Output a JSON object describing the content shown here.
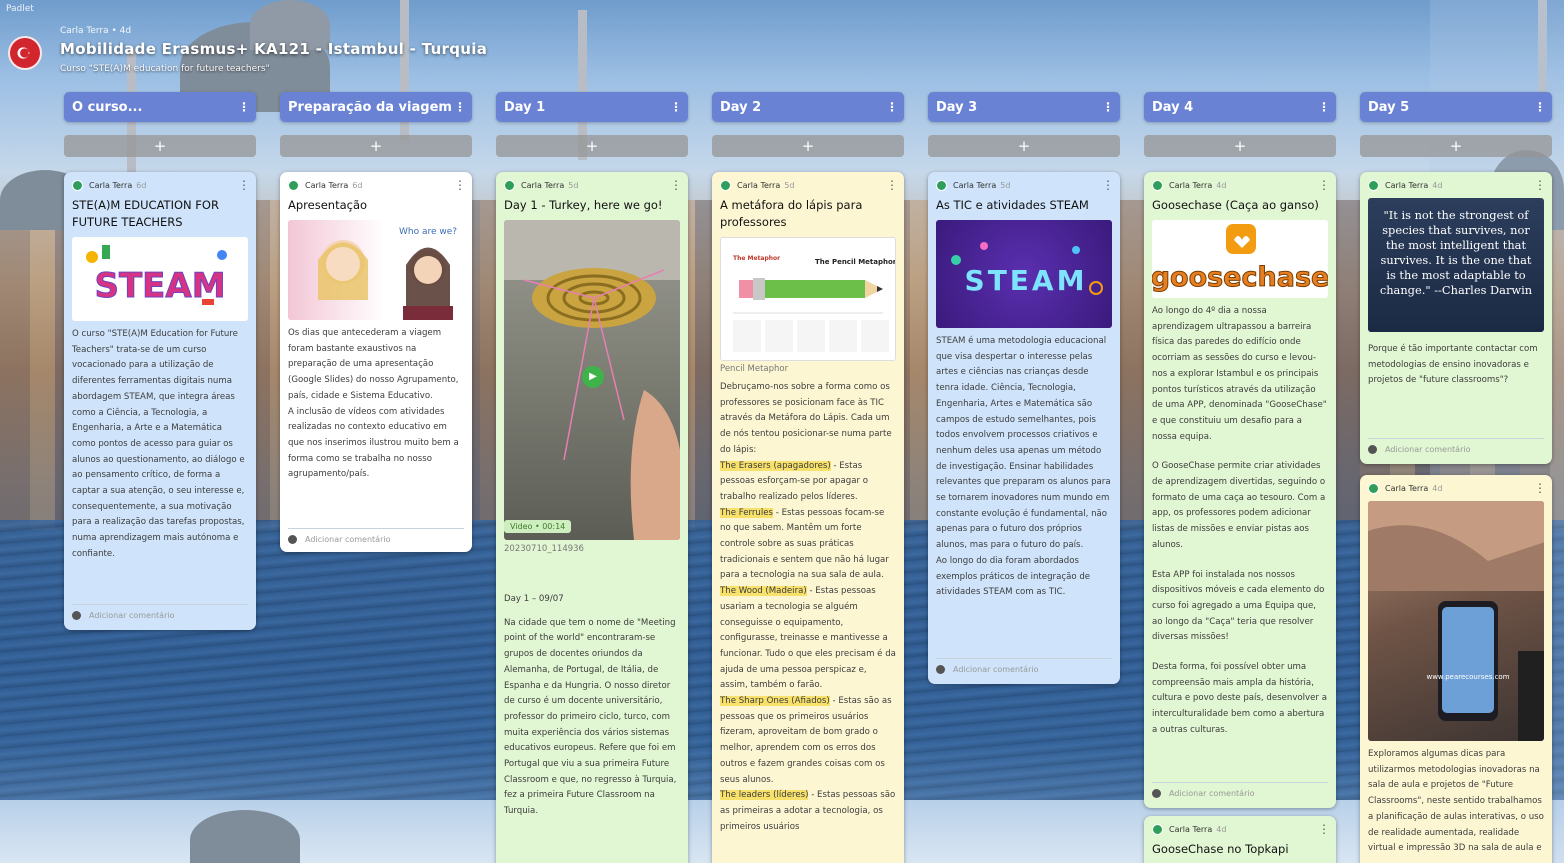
{
  "app": {
    "brand": "Padlet"
  },
  "board": {
    "author_meta": "Carla Terra • 4d",
    "title": "Mobilidade Erasmus+ KA121 - Istambul - Turquia",
    "subtitle": "Curso \"STE(A)M education for future teachers\"",
    "flag_icon": "turkey-flag-icon"
  },
  "add_label": "+",
  "comment_label": "Adicionar comentário",
  "author": "Carla Terra",
  "columns": [
    {
      "title": "O curso..."
    },
    {
      "title": "Preparação da viagem"
    },
    {
      "title": "Day 1"
    },
    {
      "title": "Day 2"
    },
    {
      "title": "Day 3"
    },
    {
      "title": "Day 4"
    },
    {
      "title": "Day 5"
    }
  ],
  "cards": {
    "c1": {
      "ago": "6d",
      "title": "STE(A)M EDUCATION FOR FUTURE TEACHERS",
      "image_text": "STEAM",
      "body": "O curso \"STE(A)M Education for Future Teachers\" trata-se de um curso vocacionado para a utilização de diferentes ferramentas digitais numa abordagem STEAM, que integra áreas como a Ciência, a Tecnologia, a Engenharia, a Arte e a Matemática como pontos de acesso para guiar os alunos ao questionamento, ao diálogo e ao pensamento crítico, de forma a captar a sua atenção, o seu interesse e, consequentemente, a sua motivação para a realização das tarefas propostas, numa aprendizagem mais autónoma e confiante."
    },
    "c2": {
      "ago": "6d",
      "title": "Apresentação",
      "image_text": "Who are we?",
      "body": "Os dias que antecederam a viagem foram bastante exaustivos na preparação de uma apresentação (Google Slides) do nosso Agrupamento, país, cidade e Sistema Educativo.\nA inclusão de vídeos com atividades realizadas no contexto educativo em que nos inserimos ilustrou muito bem a forma como se trabalha no nosso agrupamento/país."
    },
    "c3": {
      "ago": "5d",
      "title": "Day 1 - Turkey, here we go!",
      "video_label": "Video • 00:14",
      "caption": "20230710_114936",
      "body_date": "Day 1 – 09/07",
      "body": "Na cidade que tem o nome de \"Meeting point of the world\" encontraram-se grupos de docentes oriundos da Alemanha, de Portugal, de Itália, de Espanha e da Hungria. O nosso diretor de curso é um docente universitário, professor do primeiro ciclo, turco, com muita experiência dos vários sistemas educativos europeus. Refere que foi em Portugal que viu a sua primeira Future Classroom e que, no regresso à Turquia, fez a primeira Future Classroom na Turquia."
    },
    "c4": {
      "ago": "5d",
      "title": "A metáfora do lápis para professores",
      "image_title": "The Pencil Metaphor",
      "image_sub": "The Metaphor",
      "caption": "Pencil Metaphor",
      "intro": "Debruçamo-nos sobre a forma como os professores se posicionam face às TIC através da Metáfora do Lápis. Cada um de nós tentou posicionar-se numa parte do lápis:",
      "items": [
        {
          "term": "The Erasers (apagadores)",
          "text": " - Estas pessoas esforçam-se por apagar o trabalho realizado pelos líderes."
        },
        {
          "term": "The Ferrules",
          "text": " - Estas pessoas focam-se no que sabem. Mantêm um forte controle sobre as suas práticas tradicionais e sentem que não há lugar para a tecnologia na sua sala de aula."
        },
        {
          "term": "The Wood (Madeira)",
          "text": " - Estas pessoas usariam a tecnologia se alguém conseguisse o equipamento, configurasse, treinasse e mantivesse a funcionar. Tudo o que eles precisam é da ajuda de uma pessoa perspicaz e, assim, também o farão."
        },
        {
          "term": "The Sharp Ones (Afiados)",
          "text": " - Estas são as pessoas que os primeiros usuários fizeram, aproveitam de bom grado o melhor, aprendem com os erros dos outros e fazem grandes coisas com os seus alunos."
        },
        {
          "term": "The leaders (líderes)",
          "text": " - Estas pessoas são as primeiras a adotar a tecnologia, os primeiros usuários"
        }
      ]
    },
    "c5": {
      "ago": "5d",
      "title": "As TIC e atividades STEAM",
      "image_text": "STEAM",
      "body": "STEAM é uma metodologia educacional que visa despertar o interesse pelas artes e ciências nas crianças desde tenra idade. Ciência, Tecnologia, Engenharia, Artes e Matemática são campos de estudo semelhantes, pois todos envolvem processos criativos e nenhum deles usa apenas um método de investigação. Ensinar habilidades relevantes  que preparam os alunos para se tornarem inovadores num mundo em constante evolução é fundamental, não apenas para o futuro dos próprios alunos, mas para o futuro do país.\nAo longo do dia foram abordados exemplos práticos de integração de atividades STEAM com as TIC."
    },
    "c6": {
      "ago": "4d",
      "title": "Goosechase (Caça ao ganso)",
      "image_text": "goosechase",
      "body1": "Ao longo do 4º dia a nossa aprendizagem ultrapassou a barreira física das paredes do edifício onde ocorriam as sessões do curso e levou-nos a explorar Istambul e os principais pontos turísticos através da utilização de uma APP, denominada \"GooseChase\" e que constituiu um desafio para a nossa equipa.",
      "body2": "O GooseChase permite criar atividades de aprendizagem divertidas, seguindo o formato de uma caça ao tesouro. Com a app, os professores podem adicionar listas de missões e enviar pistas aos alunos.",
      "body3": "Esta APP foi instalada nos nossos dispositivos móveis e cada elemento do curso foi agregado a uma Equipa que, ao longo da \"Caça\" teria que resolver diversas missões!",
      "body4": "Desta forma, foi possível obter uma compreensão mais ampla da história, cultura e povo deste país, desenvolver a interculturalidade bem como a abertura a outras culturas."
    },
    "c7": {
      "ago": "4d",
      "title": "GooseChase no Topkapi"
    },
    "c8": {
      "ago": "4d",
      "quote": "\"It is not the strongest of species that survives, nor the most intelligent that survives. It is the one that is the most adaptable to change.\" --Charles Darwin",
      "body": "Porque é tão importante contactar com metodologias de ensino inovadoras e projetos de \"future classrooms\"?"
    },
    "c9": {
      "ago": "4d",
      "image_text": "www.pearecourses.com",
      "body": "Exploramos algumas dicas para utilizarmos metodologias inovadoras na sala de aula e projetos de \"Future Classrooms\", neste sentido trabalhamos a planificação de aulas interativas, o uso de realidade aumentada, realidade virtual e impressão 3D na sala de aula e"
    }
  }
}
